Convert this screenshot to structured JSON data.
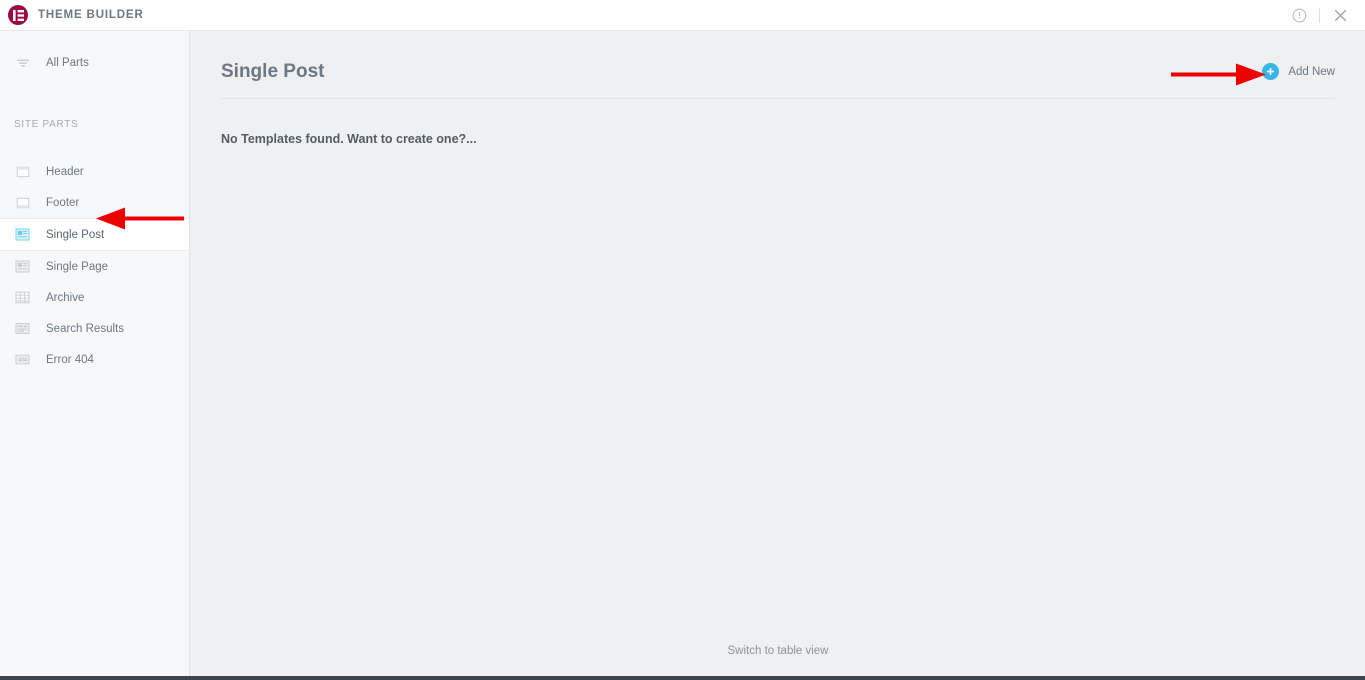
{
  "topbar": {
    "logo_icon": "elementor-logo-icon",
    "title": "THEME BUILDER",
    "info_icon": "info-circle-icon",
    "close_icon": "close-icon",
    "brand_color": "#9b0a46"
  },
  "sidebar": {
    "all_parts": {
      "label": "All Parts",
      "icon": "filter-icon"
    },
    "section_label": "SITE PARTS",
    "items": [
      {
        "label": "Header",
        "icon": "header-layout-icon",
        "active": false
      },
      {
        "label": "Footer",
        "icon": "footer-layout-icon",
        "active": false
      },
      {
        "label": "Single Post",
        "icon": "single-post-icon",
        "active": true
      },
      {
        "label": "Single Page",
        "icon": "single-page-icon",
        "active": false
      },
      {
        "label": "Archive",
        "icon": "archive-grid-icon",
        "active": false
      },
      {
        "label": "Search Results",
        "icon": "search-results-icon",
        "active": false
      },
      {
        "label": "Error 404",
        "icon": "error-404-icon",
        "active": false
      }
    ]
  },
  "main": {
    "page_title": "Single Post",
    "add_new_label": "Add New",
    "add_new_icon": "plus-circle-icon",
    "add_new_color": "#39b4e8",
    "empty_message": "No Templates found. Want to create one?...",
    "switch_view_label": "Switch to table view"
  },
  "annotations": {
    "arrow_color": "#ee0000",
    "arrow_to_sidebar_item": "Single Post",
    "arrow_to_button": "Add New"
  }
}
